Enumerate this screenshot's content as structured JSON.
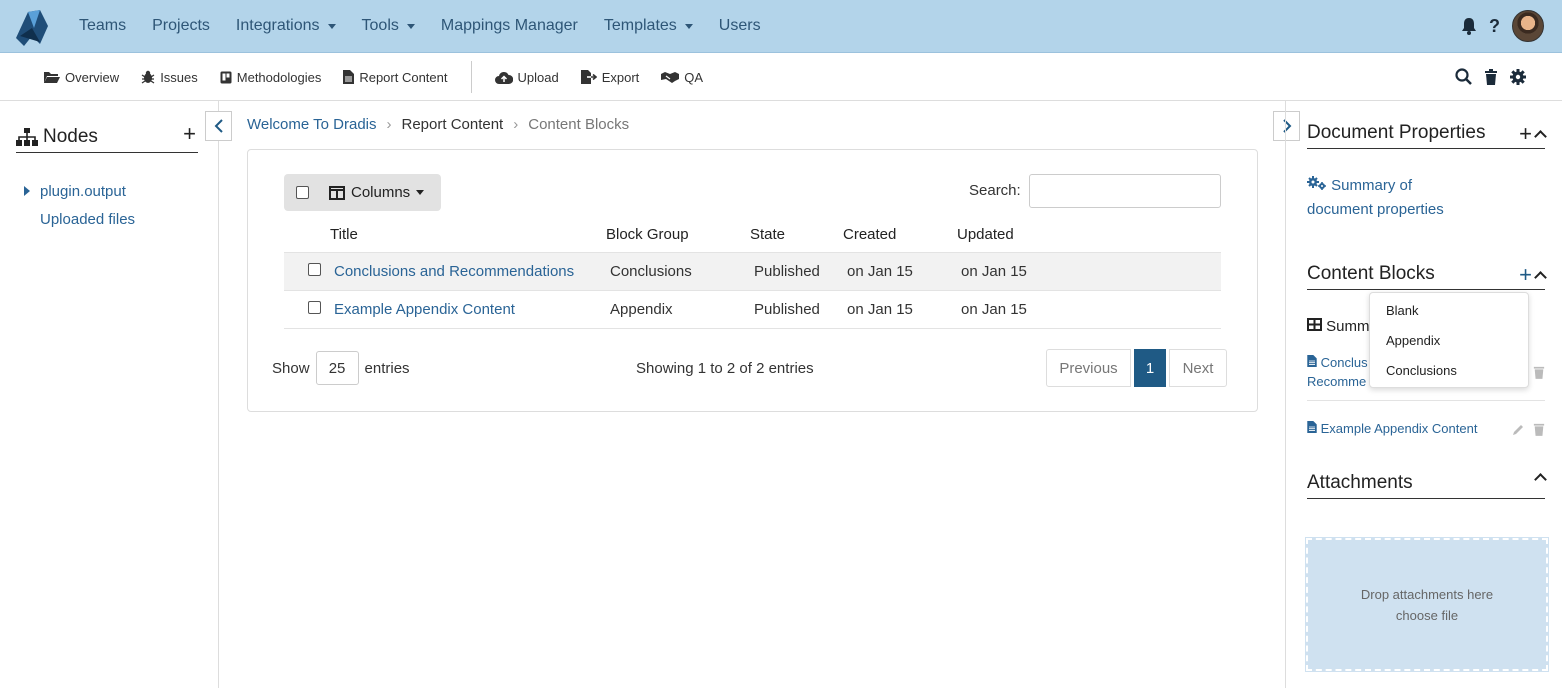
{
  "topnav": {
    "items": [
      "Teams",
      "Projects",
      "Integrations",
      "Tools",
      "Mappings Manager",
      "Templates",
      "Users"
    ],
    "help": "?"
  },
  "subnav": {
    "overview": "Overview",
    "issues": "Issues",
    "methodologies": "Methodologies",
    "report_content": "Report Content",
    "upload": "Upload",
    "export": "Export",
    "qa": "QA"
  },
  "nodes": {
    "title": "Nodes",
    "items": [
      "plugin.output",
      "Uploaded files"
    ]
  },
  "breadcrumb": [
    "Welcome To Dradis",
    "Report Content",
    "Content Blocks"
  ],
  "table": {
    "columns_button": "Columns",
    "search_label": "Search:",
    "headers": [
      "Title",
      "Block Group",
      "State",
      "Created",
      "Updated"
    ],
    "rows": [
      {
        "title": "Conclusions and Recommendations",
        "group": "Conclusions",
        "state": "Published",
        "created": "on Jan 15",
        "updated": "on Jan 15"
      },
      {
        "title": "Example Appendix Content",
        "group": "Appendix",
        "state": "Published",
        "created": "on Jan 15",
        "updated": "on Jan 15"
      }
    ],
    "show_label": "Show",
    "show_value": "25",
    "entries_label": "entries",
    "info": "Showing 1 to 2 of 2 entries",
    "prev": "Previous",
    "page": "1",
    "next": "Next"
  },
  "right": {
    "doc_props_title": "Document Properties",
    "summary_line1": "Summary of",
    "summary_line2": "document properties",
    "content_blocks_title": "Content Blocks",
    "summary_partial": "Summ",
    "block1_line1": "Conclus",
    "block1_line2": "Recomme",
    "block2": "Example Appendix Content",
    "attachments_title": "Attachments",
    "drop_text": "Drop attachments here",
    "choose_file": "choose file"
  },
  "dropdown": [
    "Blank",
    "Appendix",
    "Conclusions"
  ]
}
